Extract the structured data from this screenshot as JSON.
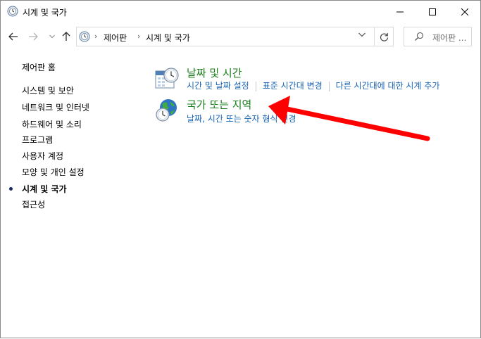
{
  "window": {
    "title": "시계 및 국가",
    "icons": {
      "app": "control-panel-clock-icon",
      "minimize": "minimize-icon",
      "maximize": "maximize-icon",
      "close": "close-icon"
    }
  },
  "navigation": {
    "back_icon": "back-arrow-icon",
    "forward_icon": "forward-arrow-icon",
    "recent_icon": "chevron-down-icon",
    "up_icon": "up-arrow-icon"
  },
  "address_bar": {
    "breadcrumbs": [
      "제어판",
      "시계 및 국가"
    ],
    "separator": "›",
    "dropdown_icon": "chevron-down-icon",
    "refresh_icon": "refresh-icon"
  },
  "search": {
    "placeholder": "제어판 ...",
    "icon": "search-icon"
  },
  "left_nav": {
    "home": "제어판 홈",
    "items": [
      "시스템 및 보안",
      "네트워크 및 인터넷",
      "하드웨어 및 소리",
      "프로그램",
      "사용자 계정",
      "모양 및 개인 설정",
      "시계 및 국가",
      "접근성"
    ],
    "active_index": 6
  },
  "categories": [
    {
      "title": "날짜 및 시간",
      "icon": "calendar-clock-icon",
      "links": [
        "시간 및 날짜 설정",
        "표준 시간대 변경",
        "다른 시간대에 대한 시계 추가"
      ]
    },
    {
      "title": "국가 또는 지역",
      "icon": "globe-clock-icon",
      "links": [
        "날짜, 시간 또는 숫자 형식 변경"
      ]
    }
  ],
  "annotation": {
    "type": "red-arrow",
    "color": "#ff0000",
    "points_to": "국가 또는 지역"
  },
  "colors": {
    "category_title": "#1a7d1a",
    "link": "#1a64b4",
    "accent_bullet": "#1a2a5e"
  }
}
